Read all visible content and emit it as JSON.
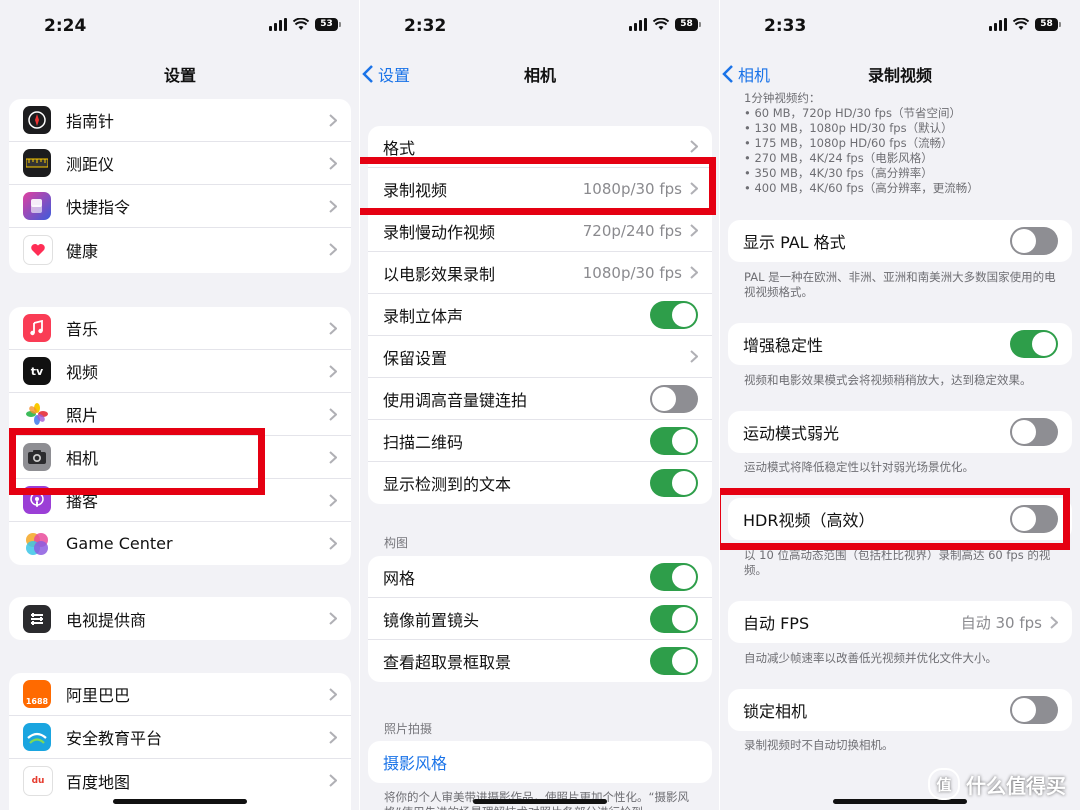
{
  "panel1": {
    "time": "2:24",
    "battery": "53",
    "title": "设置",
    "group1": [
      {
        "label": "指南针",
        "icon": "compass-icon"
      },
      {
        "label": "测距仪",
        "icon": "measure-icon"
      },
      {
        "label": "快捷指令",
        "icon": "shortcuts-icon"
      },
      {
        "label": "健康",
        "icon": "health-heart-icon"
      }
    ],
    "group2": [
      {
        "label": "音乐",
        "icon": "music-icon"
      },
      {
        "label": "视频",
        "icon": "apple-tv-icon",
        "icon_text": "tv"
      },
      {
        "label": "照片",
        "icon": "photos-icon"
      },
      {
        "label": "相机",
        "icon": "camera-icon"
      },
      {
        "label": "播客",
        "icon": "podcasts-icon"
      },
      {
        "label": "Game Center",
        "icon": "game-center-icon"
      }
    ],
    "group3": [
      {
        "label": "电视提供商",
        "icon": "tv-provider-icon"
      }
    ],
    "group4": [
      {
        "label": "阿里巴巴",
        "icon": "alibaba-icon",
        "icon_text": "1688"
      },
      {
        "label": "安全教育平台",
        "icon": "safety-education-icon"
      },
      {
        "label": "百度地图",
        "icon": "baidu-map-icon",
        "icon_text": "du"
      }
    ]
  },
  "panel2": {
    "time": "2:32",
    "battery": "58",
    "back_label": "设置",
    "title": "相机",
    "group1": [
      {
        "label": "格式",
        "value": ""
      },
      {
        "label": "录制视频",
        "value": "1080p/30 fps"
      },
      {
        "label": "录制慢动作视频",
        "value": "720p/240 fps"
      },
      {
        "label": "以电影效果录制",
        "value": "1080p/30 fps"
      },
      {
        "label": "录制立体声",
        "toggle": true
      },
      {
        "label": "保留设置",
        "value": ""
      },
      {
        "label": "使用调高音量键连拍",
        "toggle": false
      },
      {
        "label": "扫描二维码",
        "toggle": true
      },
      {
        "label": "显示检测到的文本",
        "toggle": true
      }
    ],
    "section_composition": "构图",
    "group2": [
      {
        "label": "网格",
        "toggle": true
      },
      {
        "label": "镜像前置镜头",
        "toggle": true
      },
      {
        "label": "查看超取景框取景",
        "toggle": true
      }
    ],
    "section_photo": "照片拍摄",
    "photo_style_label": "摄影风格",
    "photo_style_note": "将你的个人审美带进摄影作品，使照片更加个性化。“摄影风格”使用先进的场景理解技术对照片各部分进行恰到"
  },
  "panel3": {
    "time": "2:33",
    "battery": "58",
    "back_label": "相机",
    "title": "录制视频",
    "size_notes": [
      "1分钟视频约：",
      "• 60 MB，720p HD/30 fps（节省空间）",
      "• 130 MB，1080p HD/30 fps（默认）",
      "• 175 MB，1080p HD/60 fps（流畅）",
      "• 270 MB，4K/24 fps（电影风格）",
      "• 350 MB，4K/30 fps（高分辨率）",
      "• 400 MB，4K/60 fps（高分辨率，更流畅）"
    ],
    "pal_label": "显示 PAL 格式",
    "pal_toggle": false,
    "pal_note": "PAL 是一种在欧洲、非洲、亚洲和南美洲大多数国家使用的电视视频格式。",
    "stab_label": "增强稳定性",
    "stab_toggle": true,
    "stab_note": "视频和电影效果模式会将视频稍稍放大，达到稳定效果。",
    "action_label": "运动模式弱光",
    "action_toggle": false,
    "action_note": "运动模式将降低稳定性以针对弱光场景优化。",
    "hdr_label": "HDR视频（高效）",
    "hdr_toggle": false,
    "hdr_note": "以 10 位高动态范围（包括杜比视界）录制高达 60 fps 的视频。",
    "autofps_label": "自动 FPS",
    "autofps_value": "自动 30 fps",
    "autofps_note": "自动减少帧速率以改善低光视频并优化文件大小。",
    "lock_label": "锁定相机",
    "lock_toggle": false,
    "lock_note": "录制视频时不自动切换相机。",
    "watermark": "什么值得买",
    "watermark_badge": "值"
  },
  "colors": {
    "accent": "#1a73e8",
    "toggle_on": "#2e9e4a",
    "highlight": "#e50012"
  }
}
